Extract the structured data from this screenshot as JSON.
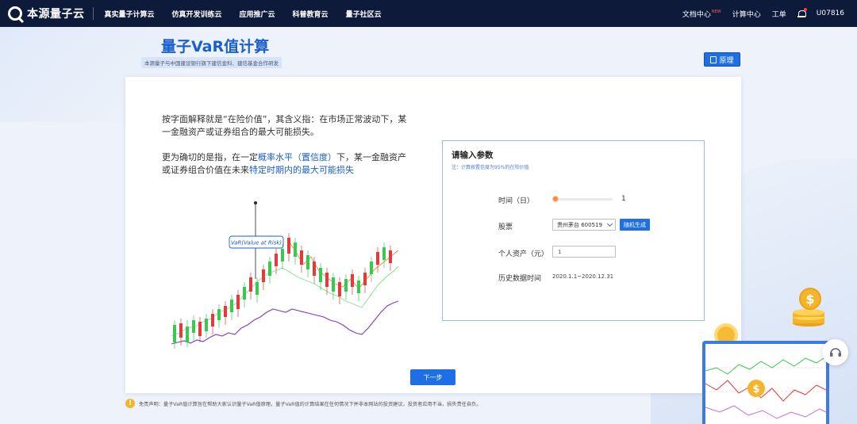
{
  "brand": {
    "name": "本源量子云"
  },
  "nav": {
    "items": [
      "真实量子计算云",
      "仿真开发训练云",
      "应用推广云",
      "科普教育云",
      "量子社区云"
    ]
  },
  "right_nav": {
    "docs": "文档中心",
    "docs_badge": "NEW",
    "compute": "计算中心",
    "tickets": "工单",
    "user": "U07816"
  },
  "page": {
    "title": "量子VaR值计算",
    "subtitle": "本源量子与中国建设银行旗下建信金科、建信基金合作研发",
    "theory_button": "原理"
  },
  "intro": {
    "para1": "按字面解释就是“在险价值”，其含义指：在市场正常波动下，某一金融资产或证券组合的最大可能损失。",
    "para2_a": "更为确切的是指，在一定",
    "para2_hl1": "概率水平（置信度）",
    "para2_b": "下，某一金融资产或证券组合价值在未来",
    "para2_hl2": "特定时期内的最大可能损失"
  },
  "chart_label": "VaR(Value at Risk)",
  "params": {
    "title": "请输入参数",
    "note": "注：计算按置信度为95%的在险价值",
    "time_label": "时间（日）",
    "time_value": "1",
    "time_fraction": 0,
    "stock_label": "股票",
    "stock_selected": "贵州茅台 600519",
    "random_button": "随机生成",
    "asset_label": "个人资产（元）",
    "asset_value": "1",
    "history_label": "历史数据时间",
    "history_value": "2020.1.1~2020.12.31"
  },
  "next_button": "下一步",
  "disclaimer": "免责声明：量子VaR值计算旨在帮助大家认识量子VaR值原理。量子VaR值的计算结果在任何情况下并非本网站的投资建议，投资者应用不当，损失责任自负。",
  "coin_symbol": "$",
  "colors": {
    "accent": "#1e6fe6",
    "topbar": "#0d1a3a",
    "highlight": "#1a5fd0",
    "warn": "#f5b52a"
  }
}
